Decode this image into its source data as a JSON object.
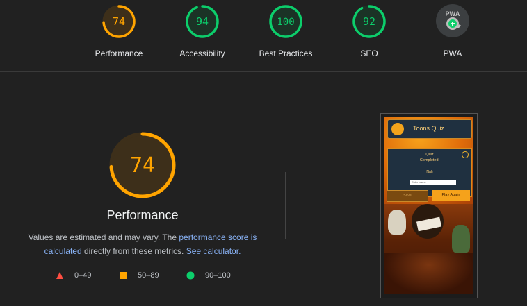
{
  "gauges": [
    {
      "label": "Performance",
      "score": "74",
      "value": 0.74,
      "color": "#ffa400",
      "track": "#3d2f1a"
    },
    {
      "label": "Accessibility",
      "score": "94",
      "value": 0.94,
      "color": "#0cce6b",
      "track": "#1b3326"
    },
    {
      "label": "Best Practices",
      "score": "100",
      "value": 1.0,
      "color": "#0cce6b",
      "track": "#1b3326"
    },
    {
      "label": "SEO",
      "score": "92",
      "value": 0.92,
      "color": "#0cce6b",
      "track": "#1b3326"
    },
    {
      "label": "PWA",
      "badge": "PWA"
    }
  ],
  "main": {
    "score": "74",
    "value": 0.74,
    "color": "#ffa400",
    "title": "Performance",
    "desc_prefix": "Values are estimated and may vary. The ",
    "link_score": "performance score is calculated",
    "desc_middle": " directly from these metrics. ",
    "link_calc": "See calculator."
  },
  "legend": [
    {
      "shape": "triangle",
      "range": "0–49",
      "color": "#ff4e42"
    },
    {
      "shape": "square",
      "range": "50–89",
      "color": "#ffa400"
    },
    {
      "shape": "circle",
      "range": "90–100",
      "color": "#0cce6b"
    }
  ],
  "screenshot": {
    "app_title": "Toons Quiz",
    "message": "Quiz\nCompleted!",
    "name_label": "Nah",
    "input_placeholder": "Enter name",
    "save_label": "Save",
    "play_label": "Play Again"
  }
}
